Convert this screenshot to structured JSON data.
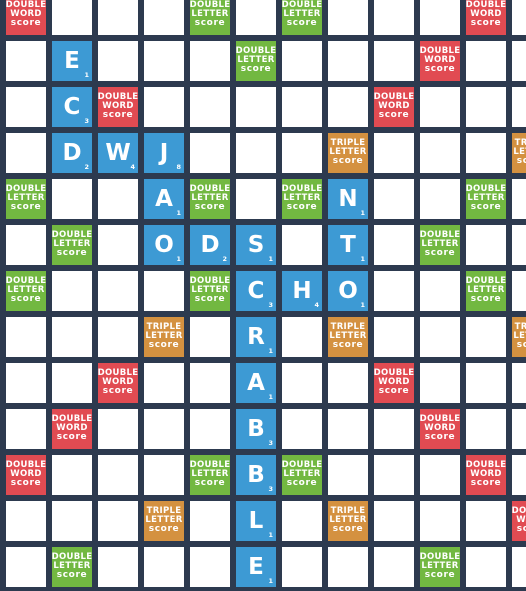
{
  "colors": {
    "grid": "#2d3a4f",
    "empty": "#ffffff",
    "tile": "#3d9ad4",
    "double_word": "#e14b52",
    "double_letter": "#72b841",
    "triple_letter": "#d49140"
  },
  "premium_labels": {
    "DW": [
      "DOUBLE",
      "WORD",
      "score"
    ],
    "DL": [
      "DOUBLE",
      "LETTER",
      "score"
    ],
    "TL": [
      "TRIPLE",
      "LETTER",
      "score"
    ]
  },
  "premium_squares": [
    {
      "row": 0,
      "col": 0,
      "type": "DW"
    },
    {
      "row": 0,
      "col": 4,
      "type": "DL"
    },
    {
      "row": 0,
      "col": 6,
      "type": "DL"
    },
    {
      "row": 0,
      "col": 10,
      "type": "DW"
    },
    {
      "row": 1,
      "col": 5,
      "type": "DL"
    },
    {
      "row": 1,
      "col": 9,
      "type": "DW"
    },
    {
      "row": 2,
      "col": 2,
      "type": "DW"
    },
    {
      "row": 2,
      "col": 8,
      "type": "DW"
    },
    {
      "row": 3,
      "col": 7,
      "type": "TL"
    },
    {
      "row": 3,
      "col": 11,
      "type": "TL"
    },
    {
      "row": 4,
      "col": 0,
      "type": "DL"
    },
    {
      "row": 4,
      "col": 4,
      "type": "DL"
    },
    {
      "row": 4,
      "col": 6,
      "type": "DL"
    },
    {
      "row": 4,
      "col": 10,
      "type": "DL"
    },
    {
      "row": 5,
      "col": 1,
      "type": "DL"
    },
    {
      "row": 5,
      "col": 9,
      "type": "DL"
    },
    {
      "row": 6,
      "col": 0,
      "type": "DL"
    },
    {
      "row": 6,
      "col": 4,
      "type": "DL"
    },
    {
      "row": 6,
      "col": 10,
      "type": "DL"
    },
    {
      "row": 7,
      "col": 3,
      "type": "TL"
    },
    {
      "row": 7,
      "col": 7,
      "type": "TL"
    },
    {
      "row": 7,
      "col": 11,
      "type": "TL"
    },
    {
      "row": 8,
      "col": 2,
      "type": "DW"
    },
    {
      "row": 8,
      "col": 8,
      "type": "DW"
    },
    {
      "row": 9,
      "col": 1,
      "type": "DW"
    },
    {
      "row": 9,
      "col": 9,
      "type": "DW"
    },
    {
      "row": 10,
      "col": 0,
      "type": "DW"
    },
    {
      "row": 10,
      "col": 4,
      "type": "DL"
    },
    {
      "row": 10,
      "col": 6,
      "type": "DL"
    },
    {
      "row": 10,
      "col": 10,
      "type": "DW"
    },
    {
      "row": 11,
      "col": 3,
      "type": "TL"
    },
    {
      "row": 11,
      "col": 7,
      "type": "TL"
    },
    {
      "row": 11,
      "col": 11,
      "type": "DW"
    },
    {
      "row": 12,
      "col": 1,
      "type": "DL"
    },
    {
      "row": 12,
      "col": 9,
      "type": "DL"
    }
  ],
  "tiles": [
    {
      "row": 1,
      "col": 1,
      "letter": "E",
      "points": "1"
    },
    {
      "row": 2,
      "col": 1,
      "letter": "C",
      "points": "3"
    },
    {
      "row": 3,
      "col": 1,
      "letter": "D",
      "points": "2"
    },
    {
      "row": 3,
      "col": 2,
      "letter": "W",
      "points": "4"
    },
    {
      "row": 3,
      "col": 3,
      "letter": "J",
      "points": "8"
    },
    {
      "row": 4,
      "col": 3,
      "letter": "A",
      "points": "1"
    },
    {
      "row": 5,
      "col": 3,
      "letter": "O",
      "points": "1"
    },
    {
      "row": 5,
      "col": 4,
      "letter": "D",
      "points": "2"
    },
    {
      "row": 5,
      "col": 5,
      "letter": "S",
      "points": "1"
    },
    {
      "row": 6,
      "col": 5,
      "letter": "C",
      "points": "3"
    },
    {
      "row": 6,
      "col": 6,
      "letter": "H",
      "points": "4"
    },
    {
      "row": 6,
      "col": 7,
      "letter": "O",
      "points": "1"
    },
    {
      "row": 4,
      "col": 7,
      "letter": "N",
      "points": "1"
    },
    {
      "row": 5,
      "col": 7,
      "letter": "T",
      "points": "1"
    },
    {
      "row": 7,
      "col": 5,
      "letter": "R",
      "points": "1"
    },
    {
      "row": 8,
      "col": 5,
      "letter": "A",
      "points": "1"
    },
    {
      "row": 9,
      "col": 5,
      "letter": "B",
      "points": "3"
    },
    {
      "row": 10,
      "col": 5,
      "letter": "B",
      "points": "3"
    },
    {
      "row": 11,
      "col": 5,
      "letter": "L",
      "points": "1"
    },
    {
      "row": 12,
      "col": 5,
      "letter": "E",
      "points": "1"
    }
  ]
}
